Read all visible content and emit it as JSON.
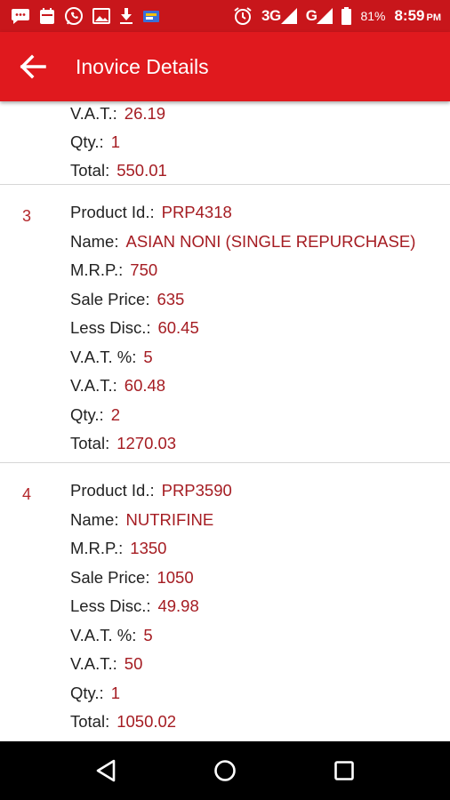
{
  "status_bar": {
    "network_3g": "3G",
    "network_g": "G",
    "battery": "81%",
    "time": "8:59",
    "ampm": "PM"
  },
  "app_bar": {
    "title": "Inovice Details"
  },
  "labels": {
    "product_id": "Product Id.:",
    "name": "Name:",
    "mrp": "M.R.P.:",
    "sale_price": "Sale Price:",
    "less_disc": "Less Disc.:",
    "vat_pct": "V.A.T. %:",
    "vat": "V.A.T.:",
    "qty": "Qty.:",
    "total": "Total:"
  },
  "items": [
    {
      "vat": "26.19",
      "qty": "1",
      "total": "550.01"
    },
    {
      "index": "3",
      "product_id": "PRP4318",
      "name": "ASIAN NONI (SINGLE REPURCHASE)",
      "mrp": "750",
      "sale_price": "635",
      "less_disc": "60.45",
      "vat_pct": "5",
      "vat": "60.48",
      "qty": "2",
      "total": "1270.03"
    },
    {
      "index": "4",
      "product_id": "PRP3590",
      "name": "NUTRIFINE",
      "mrp": "1350",
      "sale_price": "1050",
      "less_disc": "49.98",
      "vat_pct": "5",
      "vat": "50",
      "qty": "1",
      "total": "1050.02"
    }
  ],
  "icons": {
    "back": "arrow-left-icon",
    "nav_back": "triangle-back-icon",
    "nav_home": "circle-home-icon",
    "nav_recents": "square-recents-icon"
  },
  "colors": {
    "status_bar": "#c8161b",
    "app_bar": "#e0191e",
    "value_text": "#a51c22",
    "label_text": "#222222",
    "divider": "#d6d6d6"
  }
}
